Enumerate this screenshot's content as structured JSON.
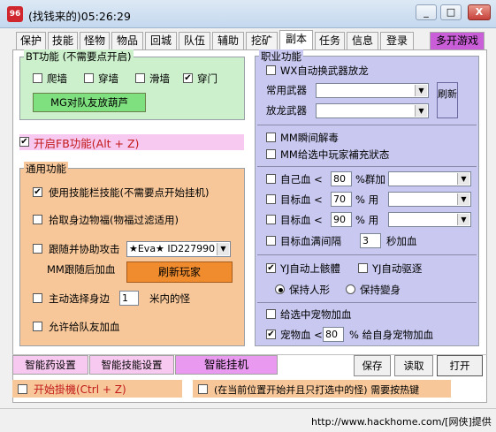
{
  "window": {
    "title": "(找钱来的)05:26:29",
    "app_icon": "shield-icon",
    "minimize": "_",
    "maximize": "□",
    "close": "X"
  },
  "tabs": [
    "保护",
    "技能",
    "怪物",
    "物品",
    "回城",
    "队伍",
    "辅助",
    "挖矿",
    "副本",
    "任务",
    "信息",
    "登录"
  ],
  "active_tab": "副本",
  "multi_game": "多开游戏",
  "bt": {
    "title": "BT功能 (不需要点开启)",
    "items": [
      {
        "label": "爬墙",
        "checked": false
      },
      {
        "label": "穿墙",
        "checked": false
      },
      {
        "label": "滑墙",
        "checked": false
      },
      {
        "label": "穿门",
        "checked": true
      }
    ],
    "mg_button": "MG对队友放葫芦"
  },
  "fb": {
    "label": "开启FB功能(Alt + Z)",
    "checked": true
  },
  "general": {
    "title": "通用功能",
    "use_skill": {
      "label": "使用技能栏技能(不需要点开始挂机)",
      "checked": true
    },
    "pick_bat": {
      "label": "拾取身边物福(物福过滤适用)",
      "checked": false
    },
    "follow": {
      "label": "跟随并协助攻击",
      "checked": false
    },
    "follow_target": "★Eva★  ID227990",
    "mm_follow": "MM跟随后加血",
    "refresh_player": "刷新玩家",
    "select_nearby": {
      "label": "主动选择身边",
      "checked": false
    },
    "nearby_value": "1",
    "nearby_suffix": "米内的怪",
    "allow_heal": {
      "label": "允许给队友加血",
      "checked": false
    }
  },
  "job": {
    "title": "职业功能",
    "wx_auto": {
      "label": "WX自动换武器放龙",
      "checked": false
    },
    "common_weapon": "常用武器",
    "dragon_weapon": "放龙武器",
    "refresh": "刷新",
    "mm_detox": {
      "label": "MM瞬间解毒",
      "checked": false
    },
    "mm_buff": {
      "label": "MM给选中玩家補充狀态",
      "checked": false
    },
    "heal_rows": [
      {
        "prefix": "自己血 <",
        "value": "80",
        "suffix": "%群加",
        "checked": false
      },
      {
        "prefix": "目标血 <",
        "value": "70",
        "suffix": "% 用",
        "checked": false
      },
      {
        "prefix": "目标血 <",
        "value": "90",
        "suffix": "% 用",
        "checked": false
      }
    ],
    "full_interval": {
      "label": "目标血满间隔",
      "checked": false
    },
    "full_value": "3",
    "full_suffix": "秒加血",
    "yj_mount": {
      "label": "YJ自动上骸體",
      "checked": true
    },
    "yj_drive": {
      "label": "YJ自动驱逐",
      "checked": false
    },
    "keep_human": "保持人形",
    "keep_form": "保持變身",
    "keep_choice": "human",
    "pet_heal": {
      "label": "给选中宠物加血",
      "checked": false
    },
    "pet_blood": {
      "label": "宠物血 <",
      "checked": true
    },
    "pet_value": "80",
    "pet_suffix": "% 给自身宠物加血"
  },
  "bottom": {
    "smart_medicine": "智能药设置",
    "smart_skill": "智能技能设置",
    "smart_hang": "智能挂机",
    "save": "保存",
    "read": "读取",
    "open": "打开",
    "start_hang": {
      "label": "开始掛機(Ctrl + Z)",
      "checked": false
    },
    "hint": {
      "label": "(在当前位置开始并且只打选中的怪) 需要按热键",
      "checked": false
    }
  },
  "watermark": "http://www.hackhome.com/[网侠]提供",
  "colors": {
    "bt_bg": "#ccf0cc",
    "general_bg": "#f7c79a",
    "job_bg": "#c8c8f0",
    "fb_bg": "#f7c8f0",
    "accent_pink": "#e99af0"
  }
}
